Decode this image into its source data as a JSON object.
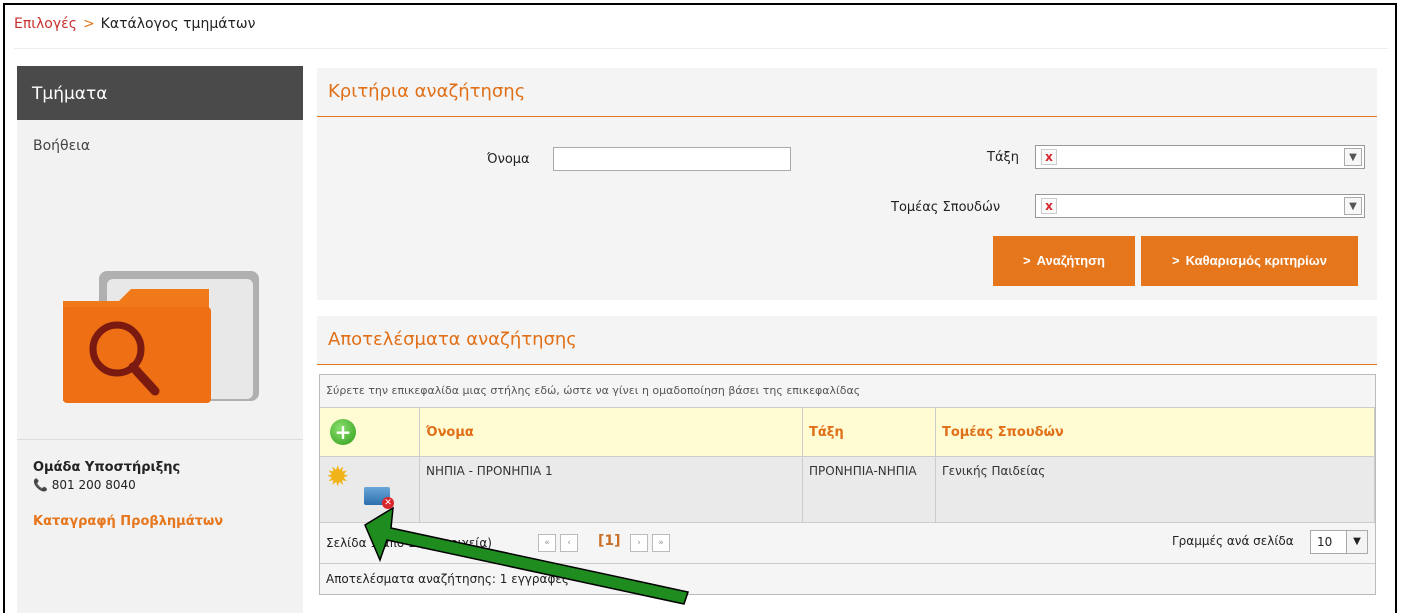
{
  "breadcrumb": {
    "home": "Επιλογές",
    "separator": ">",
    "current": "Κατάλογος τμημάτων"
  },
  "sidebar": {
    "title": "Τμήματα",
    "help": "Βοήθεια",
    "support_title": "Ομάδα Υποστήριξης",
    "phone": "801 200 8040",
    "report_link": "Καταγραφή Προβλημάτων"
  },
  "search": {
    "title": "Κριτήρια αναζήτησης",
    "name_label": "Όνομα",
    "name_value": "",
    "class_label": "Τάξη",
    "sector_label": "Τομέας Σπουδών",
    "clear_glyph": "x",
    "search_button": "Αναζήτηση",
    "reset_button": "Καθαρισμός κριτηρίων"
  },
  "results": {
    "title": "Αποτελέσματα αναζήτησης",
    "group_hint": "Σύρετε την επικεφαλίδα μιας στήλης εδώ, ώστε να γίνει η ομαδοποίηση βάσει της επικεφαλίδας",
    "columns": [
      "Όνομα",
      "Τάξη",
      "Τομέας Σπουδών"
    ],
    "rows": [
      {
        "name": "ΝΗΠΙΑ - ΠΡΟΝΗΠΙΑ 1",
        "class": "ΠΡΟΝΗΠΙΑ-ΝΗΠΙΑ",
        "sector": "Γενικής Παιδείας"
      }
    ],
    "pager_info": "Σελίδα 1 από 1 (1 στοιχεία)",
    "current_page": "[1]",
    "rows_per_page_label": "Γραμμές ανά σελίδα",
    "rows_per_page_value": "10",
    "count_text": "Αποτελέσματα αναζήτησης: 1 εγγραφές"
  },
  "colors": {
    "accent": "#e6761b",
    "sidebar_header": "#4a4a4a",
    "header_row": "#fffbd3",
    "arrow": "#1e8c1e"
  }
}
